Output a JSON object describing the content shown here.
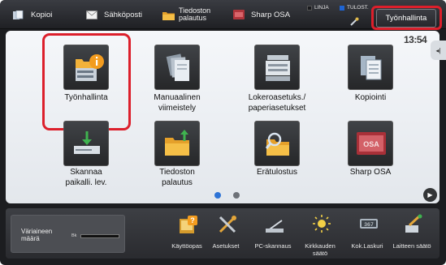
{
  "topbar": {
    "items": [
      {
        "label": "Kopioi",
        "icon": "copy-icon"
      },
      {
        "label": "Sähköposti",
        "icon": "envelope-icon"
      },
      {
        "label": "Tiedoston\npalautus",
        "icon": "folder-icon"
      },
      {
        "label": "Sharp OSA",
        "icon": "osa-icon"
      }
    ],
    "status": {
      "line": "LINJA",
      "print": "TULOST."
    },
    "job_status_button": "Työnhallinta"
  },
  "clock": "13:54",
  "home_icons": [
    {
      "label": "Työnhallinta",
      "icon": "job-status-icon"
    },
    {
      "label": "Manuaalinen\nviimeistely",
      "icon": "finishing-icon"
    },
    {
      "label": "Lokeroasetuks./\npaperiasetukset",
      "icon": "tray-settings-icon"
    },
    {
      "label": "Kopiointi",
      "icon": "copy-icon"
    },
    {
      "label": "Skannaa\npaikalli. lev.",
      "icon": "scan-to-drive-icon"
    },
    {
      "label": "Tiedoston\npalautus",
      "icon": "folder-icon"
    },
    {
      "label": "Erätulostus",
      "icon": "batch-print-icon"
    },
    {
      "label": "Sharp OSA",
      "icon": "osa-icon"
    }
  ],
  "pagination": {
    "current": 1,
    "total": 2
  },
  "toner": {
    "label": "Väriaineen\nmäärä",
    "color_code": "Bk",
    "level": "full"
  },
  "bottom_icons": [
    {
      "label": "Käyttöopas",
      "icon": "manual-book-icon"
    },
    {
      "label": "Asetukset",
      "icon": "tools-icon"
    },
    {
      "label": "PC-skannaus",
      "icon": "pc-scan-icon"
    },
    {
      "label": "Kirkkauden\nsäätö",
      "icon": "brightness-icon"
    },
    {
      "label": "Kok.Laskuri",
      "icon": "counter-icon"
    },
    {
      "label": "Laitteen säätö",
      "icon": "device-adjust-icon"
    }
  ],
  "colors": {
    "highlight": "#dc1f2b",
    "line_status": "#1e64d2",
    "print_status": "#1e64d2"
  }
}
